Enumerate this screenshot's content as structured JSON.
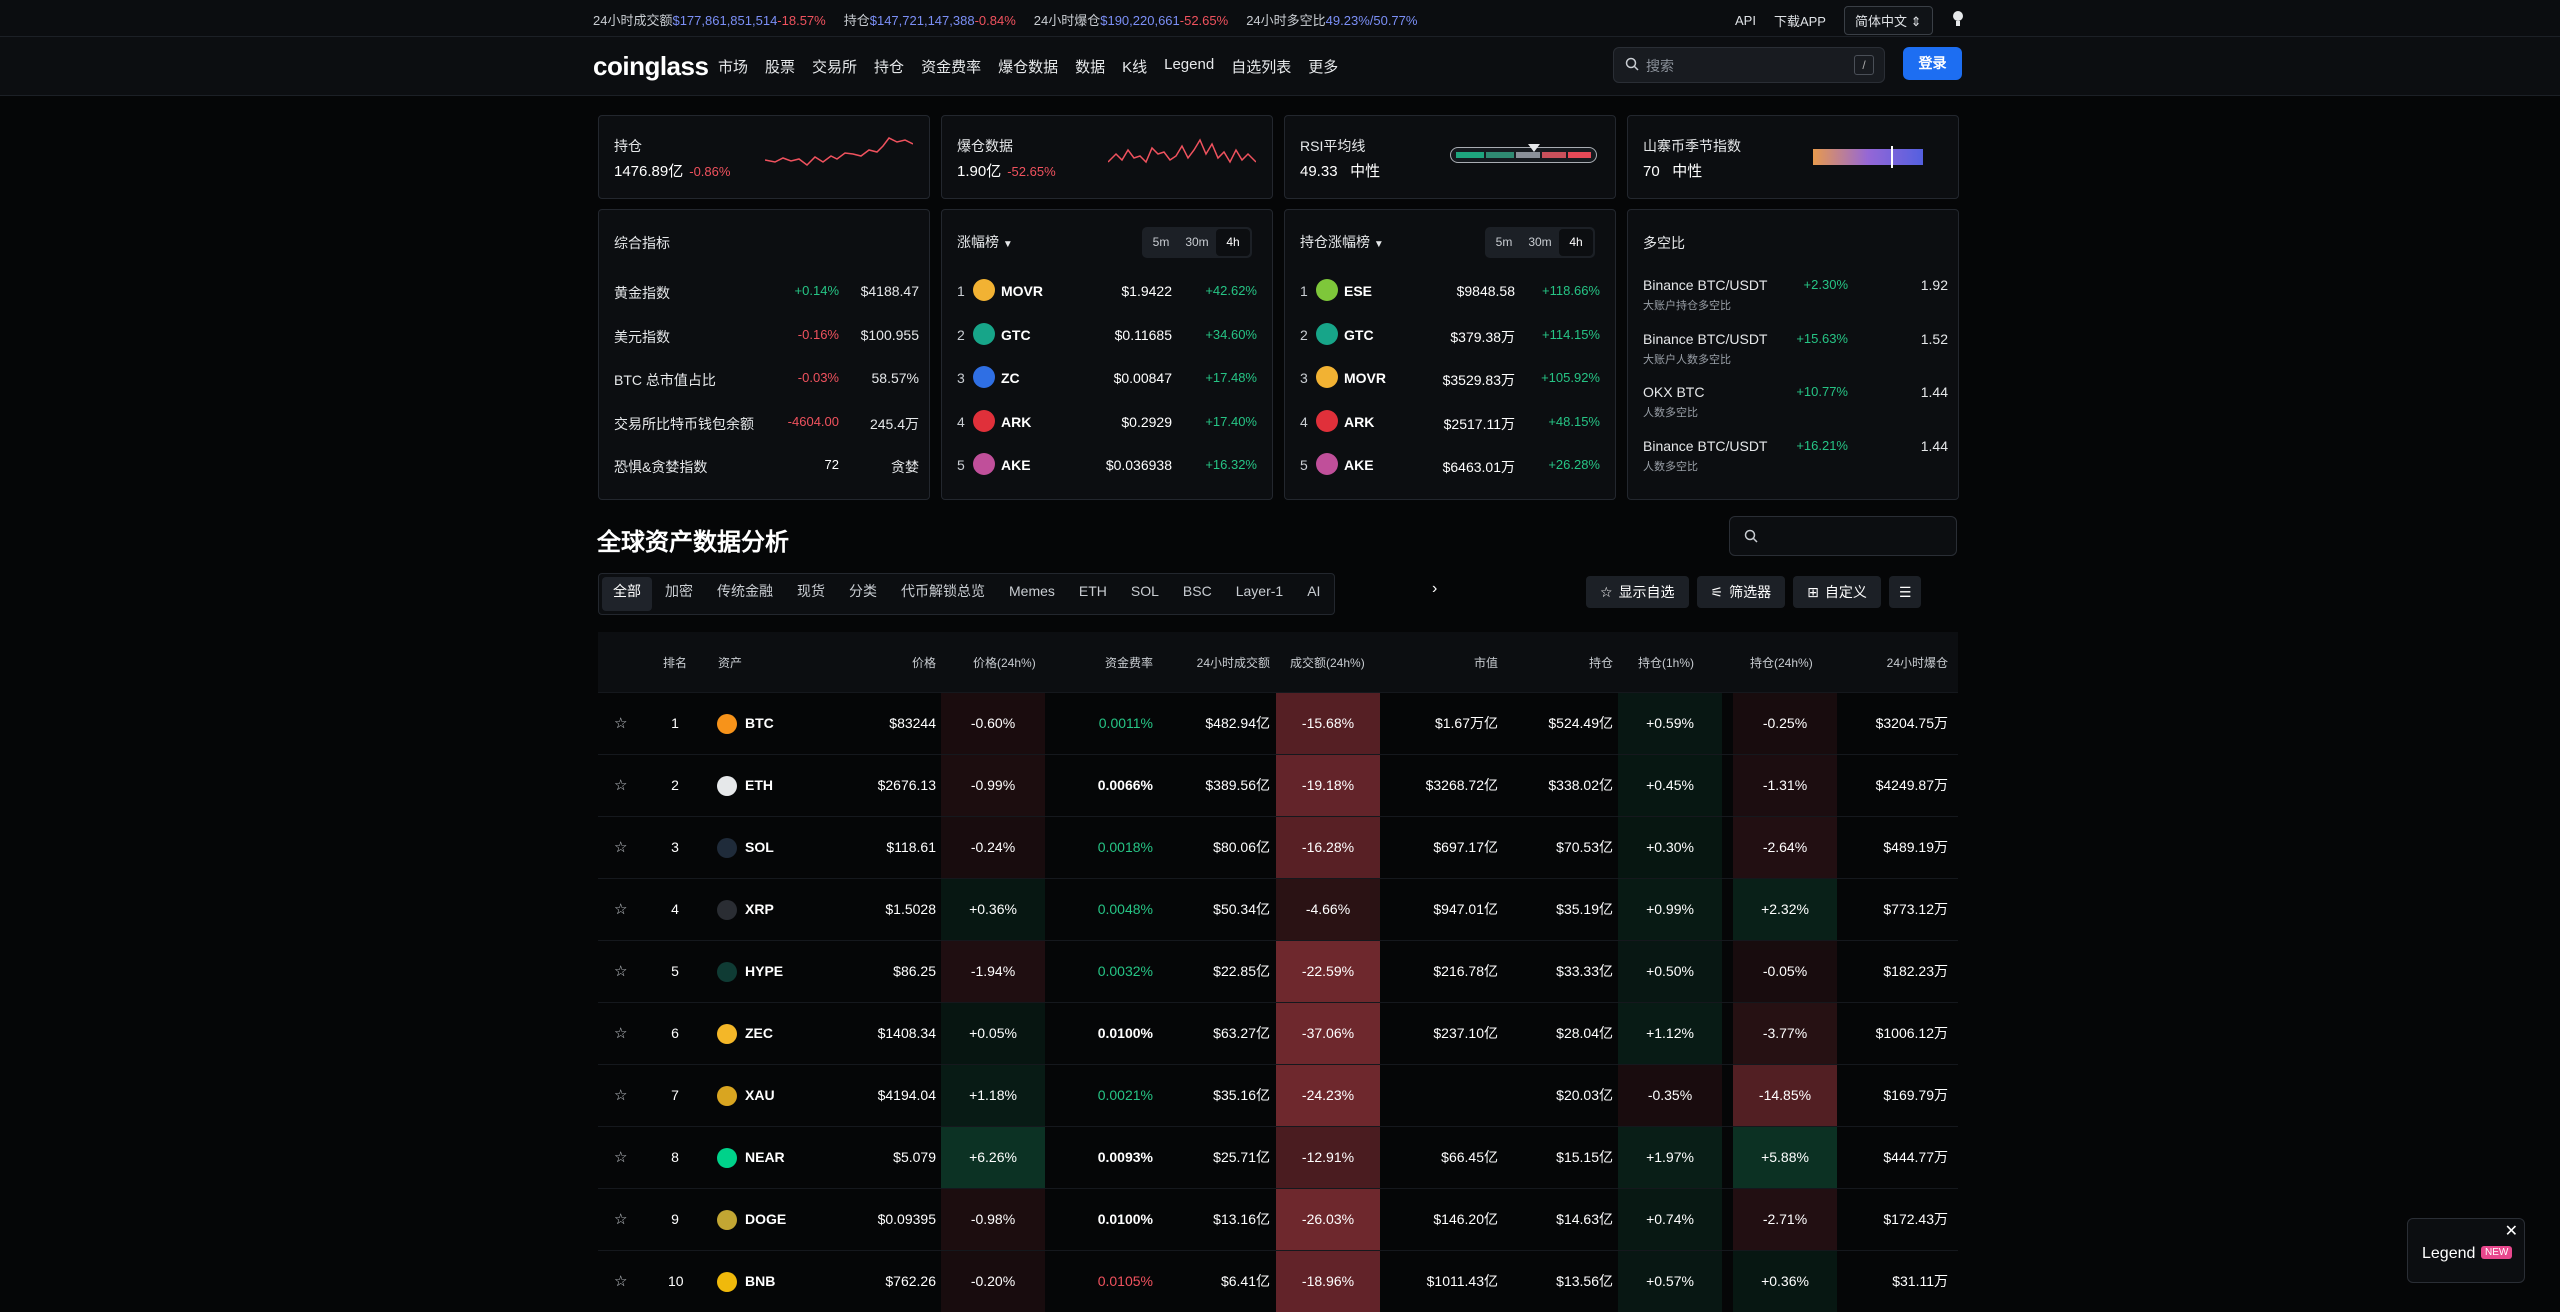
{
  "topbar": {
    "stats": [
      {
        "label": "24小时成交额",
        "value": "$177,861,851,514",
        "change": "-18.57%",
        "dir": "neg"
      },
      {
        "label": "持仓",
        "value": "$147,721,147,388",
        "change": "-0.84%",
        "dir": "neg"
      },
      {
        "label": "24小时爆仓",
        "value": "$190,220,661",
        "change": "-52.65%",
        "dir": "neg"
      },
      {
        "label": "24小时多空比",
        "value": "49.23%/50.77%",
        "change": "",
        "dir": "neg"
      }
    ],
    "api": "API",
    "download": "下载APP",
    "language": "简体中文"
  },
  "nav": {
    "logo": "coinglass",
    "menu": [
      "市场",
      "股票",
      "交易所",
      "持仓",
      "资金费率",
      "爆仓数据",
      "数据",
      "K线",
      "Legend",
      "自选列表",
      "更多"
    ],
    "search_placeholder": "搜索",
    "search_shortcut": "/",
    "login": "登录"
  },
  "cards": {
    "oi": {
      "title": "持仓",
      "value": "1476.89亿",
      "change": "-0.86%"
    },
    "liq": {
      "title": "爆仓数据",
      "value": "1.90亿",
      "change": "-52.65%"
    },
    "rsi": {
      "title": "RSI平均线",
      "value": "49.33",
      "status": "中性"
    },
    "altseason": {
      "title": "山寨币季节指数",
      "value": "70",
      "status": "中性"
    }
  },
  "composite": {
    "title": "综合指标",
    "rows": [
      {
        "label": "黄金指数",
        "change": "+0.14%",
        "dir": "pos",
        "value": "$4188.47"
      },
      {
        "label": "美元指数",
        "change": "-0.16%",
        "dir": "neg",
        "value": "$100.955"
      },
      {
        "label": "BTC 总市值占比",
        "change": "-0.03%",
        "dir": "neg",
        "value": "58.57%"
      },
      {
        "label": "交易所比特币钱包余额",
        "change": "-4604.00",
        "dir": "neg",
        "value": "245.4万"
      },
      {
        "label": "恐惧&贪婪指数",
        "change": "72",
        "dir": "plain",
        "value": "贪婪"
      }
    ]
  },
  "gainers": {
    "title": "涨幅榜",
    "intervals": [
      "5m",
      "30m",
      "4h"
    ],
    "active": "4h",
    "rows": [
      {
        "rank": "1",
        "symbol": "MOVR",
        "price": "$1.9422",
        "change": "+42.62%",
        "color": "#f2b233"
      },
      {
        "rank": "2",
        "symbol": "GTC",
        "price": "$0.11685",
        "change": "+34.60%",
        "color": "#17a589"
      },
      {
        "rank": "3",
        "symbol": "ZC",
        "price": "$0.00847",
        "change": "+17.48%",
        "color": "#2f6fe4"
      },
      {
        "rank": "4",
        "symbol": "ARK",
        "price": "$0.2929",
        "change": "+17.40%",
        "color": "#e0303a"
      },
      {
        "rank": "5",
        "symbol": "AKE",
        "price": "$0.036938",
        "change": "+16.32%",
        "color": "#c04f9a"
      }
    ]
  },
  "oi_gainers": {
    "title": "持仓涨幅榜",
    "intervals": [
      "5m",
      "30m",
      "4h"
    ],
    "active": "4h",
    "rows": [
      {
        "rank": "1",
        "symbol": "ESE",
        "price": "$9848.58",
        "change": "+118.66%",
        "color": "#7ec73a"
      },
      {
        "rank": "2",
        "symbol": "GTC",
        "price": "$379.38万",
        "change": "+114.15%",
        "color": "#17a589"
      },
      {
        "rank": "3",
        "symbol": "MOVR",
        "price": "$3529.83万",
        "change": "+105.92%",
        "color": "#f2b233"
      },
      {
        "rank": "4",
        "symbol": "ARK",
        "price": "$2517.11万",
        "change": "+48.15%",
        "color": "#e0303a"
      },
      {
        "rank": "5",
        "symbol": "AKE",
        "price": "$6463.01万",
        "change": "+26.28%",
        "color": "#c04f9a"
      }
    ]
  },
  "longshort": {
    "title": "多空比",
    "rows": [
      {
        "name": "Binance BTC/USDT",
        "sub": "大账户持仓多空比",
        "change": "+2.30%",
        "value": "1.92"
      },
      {
        "name": "Binance BTC/USDT",
        "sub": "大账户人数多空比",
        "change": "+15.63%",
        "value": "1.52"
      },
      {
        "name": "OKX BTC",
        "sub": "人数多空比",
        "change": "+10.77%",
        "value": "1.44"
      },
      {
        "name": "Binance BTC/USDT",
        "sub": "人数多空比",
        "change": "+16.21%",
        "value": "1.44"
      }
    ]
  },
  "section": {
    "title": "全球资产数据分析",
    "tabs": [
      "全部",
      "加密",
      "传统金融",
      "现货",
      "分类",
      "代币解锁总览",
      "Memes",
      "ETH",
      "SOL",
      "BSC",
      "Layer-1",
      "AI"
    ],
    "show_favorites": "显示自选",
    "filter": "筛选器",
    "customize": "自定义"
  },
  "table": {
    "headers": [
      "排名",
      "资产",
      "价格",
      "价格(24h%)",
      "资金费率",
      "24小时成交额",
      "成交额(24h%)",
      "市值",
      "持仓",
      "持仓(1h%)",
      "持仓(24h%)",
      "24小时爆仓"
    ],
    "rows": [
      {
        "rank": "1",
        "asset": "BTC",
        "color": "#f7931a",
        "price": "$83244",
        "pchg": "-0.60%",
        "fund": "0.0011%",
        "fcol": "pos",
        "vol": "$482.94亿",
        "vchg": "-15.68%",
        "mcap": "$1.67万亿",
        "oi": "$524.49亿",
        "oi1": "+0.59%",
        "oi24": "-0.25%",
        "liq": "$3204.75万"
      },
      {
        "rank": "2",
        "asset": "ETH",
        "color": "#e6e8ea",
        "price": "$2676.13",
        "pchg": "-0.99%",
        "fund": "0.0066%",
        "fcol": "white",
        "vol": "$389.56亿",
        "vchg": "-19.18%",
        "mcap": "$3268.72亿",
        "oi": "$338.02亿",
        "oi1": "+0.45%",
        "oi24": "-1.31%",
        "liq": "$4249.87万"
      },
      {
        "rank": "3",
        "asset": "SOL",
        "color": "#1f2b3a",
        "price": "$118.61",
        "pchg": "-0.24%",
        "fund": "0.0018%",
        "fcol": "pos",
        "vol": "$80.06亿",
        "vchg": "-16.28%",
        "mcap": "$697.17亿",
        "oi": "$70.53亿",
        "oi1": "+0.30%",
        "oi24": "-2.64%",
        "liq": "$489.19万"
      },
      {
        "rank": "4",
        "asset": "XRP",
        "color": "#2a2d33",
        "price": "$1.5028",
        "pchg": "+0.36%",
        "fund": "0.0048%",
        "fcol": "pos",
        "vol": "$50.34亿",
        "vchg": "-4.66%",
        "mcap": "$947.01亿",
        "oi": "$35.19亿",
        "oi1": "+0.99%",
        "oi24": "+2.32%",
        "liq": "$773.12万"
      },
      {
        "rank": "5",
        "asset": "HYPE",
        "color": "#0f3b34",
        "price": "$86.25",
        "pchg": "-1.94%",
        "fund": "0.0032%",
        "fcol": "pos",
        "vol": "$22.85亿",
        "vchg": "-22.59%",
        "mcap": "$216.78亿",
        "oi": "$33.33亿",
        "oi1": "+0.50%",
        "oi24": "-0.05%",
        "liq": "$182.23万"
      },
      {
        "rank": "6",
        "asset": "ZEC",
        "color": "#f4b728",
        "price": "$1408.34",
        "pchg": "+0.05%",
        "fund": "0.0100%",
        "fcol": "white",
        "vol": "$63.27亿",
        "vchg": "-37.06%",
        "mcap": "$237.10亿",
        "oi": "$28.04亿",
        "oi1": "+1.12%",
        "oi24": "-3.77%",
        "liq": "$1006.12万"
      },
      {
        "rank": "7",
        "asset": "XAU",
        "color": "#d9a520",
        "price": "$4194.04",
        "pchg": "+1.18%",
        "fund": "0.0021%",
        "fcol": "pos",
        "vol": "$35.16亿",
        "vchg": "-24.23%",
        "mcap": "",
        "oi": "$20.03亿",
        "oi1": "-0.35%",
        "oi24": "-14.85%",
        "liq": "$169.79万"
      },
      {
        "rank": "8",
        "asset": "NEAR",
        "color": "#00d28a",
        "price": "$5.079",
        "pchg": "+6.26%",
        "fund": "0.0093%",
        "fcol": "white",
        "vol": "$25.71亿",
        "vchg": "-12.91%",
        "mcap": "$66.45亿",
        "oi": "$15.15亿",
        "oi1": "+1.97%",
        "oi24": "+5.88%",
        "liq": "$444.77万"
      },
      {
        "rank": "9",
        "asset": "DOGE",
        "color": "#c2a633",
        "price": "$0.09395",
        "pchg": "-0.98%",
        "fund": "0.0100%",
        "fcol": "white",
        "vol": "$13.16亿",
        "vchg": "-26.03%",
        "mcap": "$146.20亿",
        "oi": "$14.63亿",
        "oi1": "+0.74%",
        "oi24": "-2.71%",
        "liq": "$172.43万"
      },
      {
        "rank": "10",
        "asset": "BNB",
        "color": "#f0b90b",
        "price": "$762.26",
        "pchg": "-0.20%",
        "fund": "0.0105%",
        "fcol": "neg",
        "vol": "$6.41亿",
        "vchg": "-18.96%",
        "mcap": "$1011.43亿",
        "oi": "$13.56亿",
        "oi1": "+0.57%",
        "oi24": "+0.36%",
        "liq": "$31.11万"
      }
    ]
  },
  "legend_popup": {
    "label": "Legend",
    "badge": "NEW"
  }
}
